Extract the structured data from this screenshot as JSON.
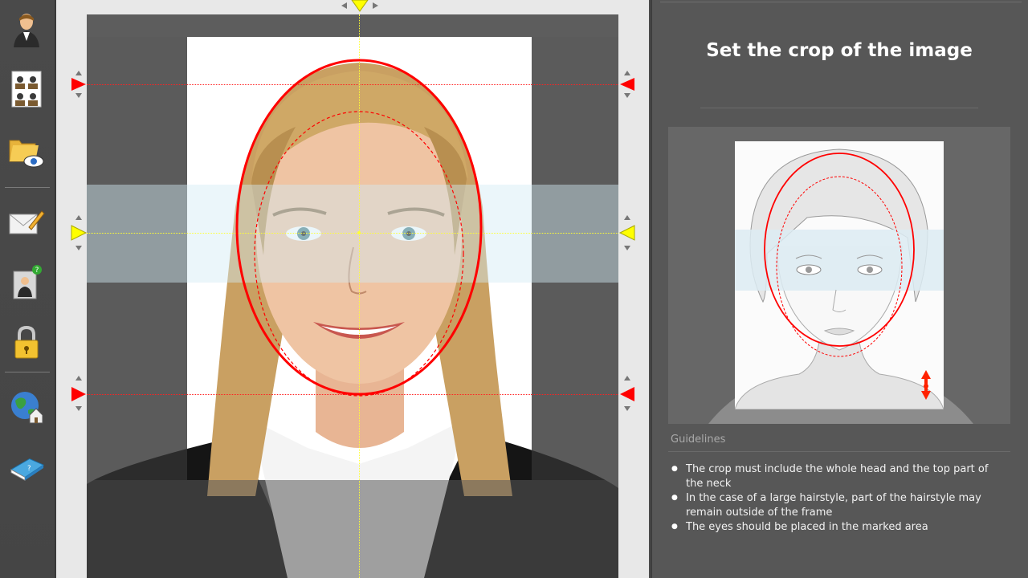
{
  "toolbar": {
    "items": [
      {
        "icon": "person-icon"
      },
      {
        "icon": "photo-sheet-icon"
      },
      {
        "icon": "folder-view-icon"
      },
      {
        "icon": "mail-edit-icon"
      },
      {
        "icon": "photo-help-icon"
      },
      {
        "icon": "lock-icon"
      },
      {
        "icon": "globe-home-icon"
      },
      {
        "icon": "help-book-icon"
      }
    ]
  },
  "editor": {
    "crop_ellipse_color": "#ff0000",
    "guide_color": "#ffff00",
    "eye_band_color": "#d2ebf5"
  },
  "panel": {
    "title": "Set the crop of the image",
    "guidelines_label": "Guidelines",
    "guidelines": [
      "The crop must include the whole head and the top part of the neck",
      "In the case of a large hairstyle, part of the hairstyle may remain outside of the frame",
      "The eyes should be placed in the marked area"
    ]
  }
}
